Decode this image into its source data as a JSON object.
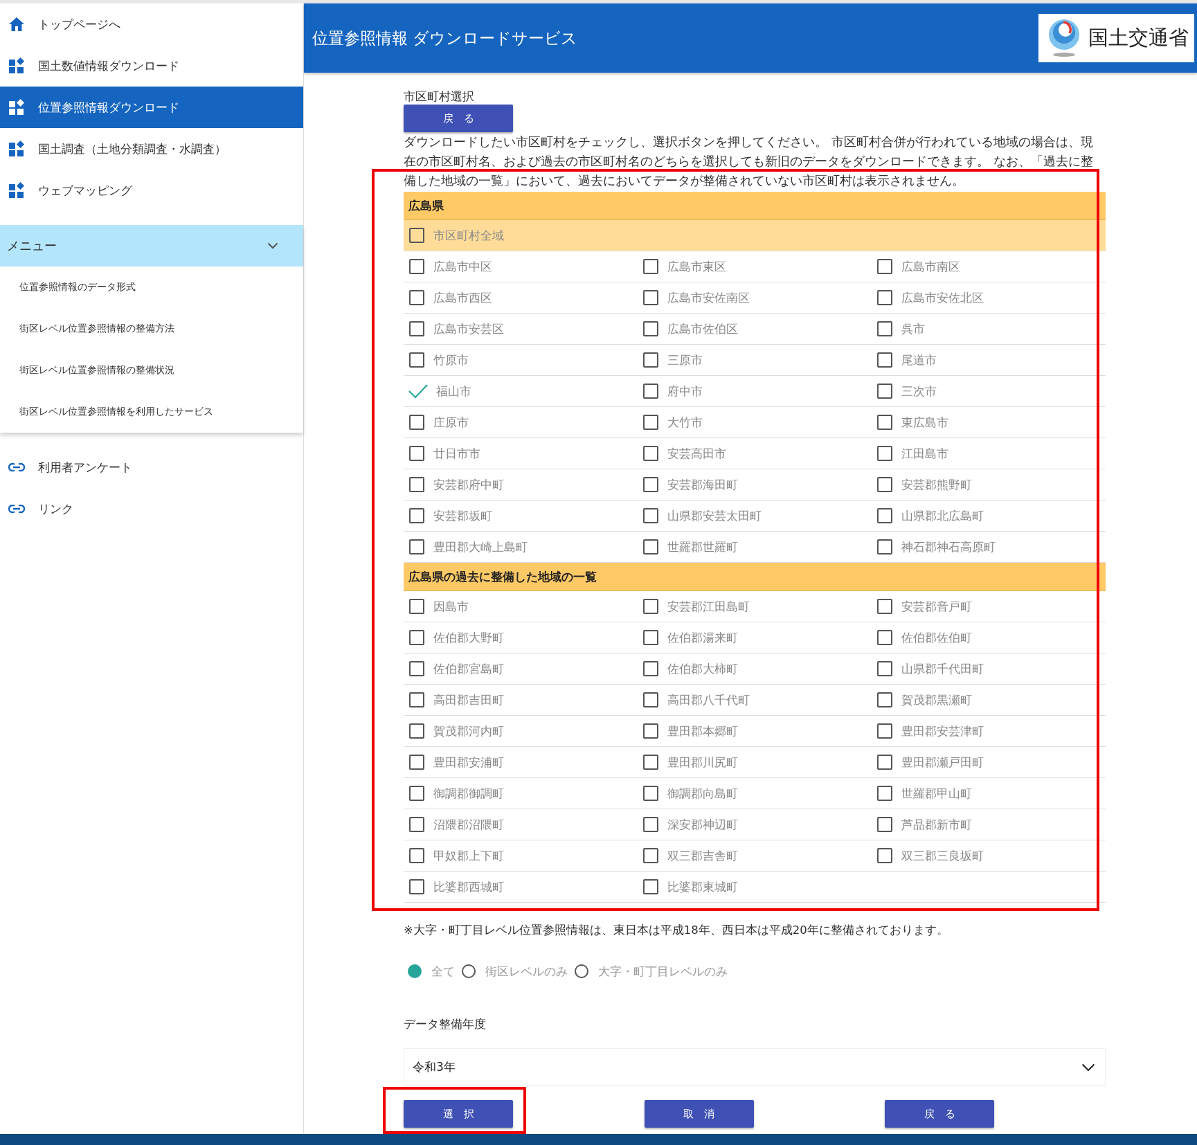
{
  "sidebar": {
    "nav_items": [
      {
        "label": "トップページへ",
        "kind": "home",
        "selected": false
      },
      {
        "label": "国土数値情報ダウンロード",
        "kind": "widget",
        "selected": false
      },
      {
        "label": "位置参照情報ダウンロード",
        "kind": "widget",
        "selected": true
      },
      {
        "label": "国土調査（土地分類調査・水調査）",
        "kind": "widget",
        "selected": false
      },
      {
        "label": "ウェブマッピング",
        "kind": "widget",
        "selected": false
      }
    ],
    "menu": {
      "title": "メニュー",
      "expanded": true,
      "items": [
        "位置参照情報のデータ形式",
        "街区レベル位置参照情報の整備方法",
        "街区レベル位置参照情報の整備状況",
        "街区レベル位置参照情報を利用したサービス"
      ]
    },
    "links": [
      "利用者アンケート",
      "リンク"
    ]
  },
  "header": {
    "title": "位置参照情報 ダウンロードサービス",
    "logo_text": "国土交通省"
  },
  "content": {
    "heading": "市区町村選択",
    "back_button": "戻　る",
    "description": "ダウンロードしたい市区町村をチェックし、選択ボタンを押してください。 市区町村合併が行われている地域の場合は、現在の市区町村名、および過去の市区町村名のどちらを選択しても新旧のデータをダウンロードできます。 なお、「過去に整備した地域の一覧」において、過去においてデータが整備されていない市区町村は表示されません。",
    "list_highlighted": true,
    "groups": [
      {
        "title": "広島県",
        "all_option": {
          "label": "市区町村全域",
          "checked": false
        },
        "items": [
          {
            "label": "広島市中区",
            "checked": false
          },
          {
            "label": "広島市東区",
            "checked": false
          },
          {
            "label": "広島市南区",
            "checked": false
          },
          {
            "label": "広島市西区",
            "checked": false
          },
          {
            "label": "広島市安佐南区",
            "checked": false
          },
          {
            "label": "広島市安佐北区",
            "checked": false
          },
          {
            "label": "広島市安芸区",
            "checked": false
          },
          {
            "label": "広島市佐伯区",
            "checked": false
          },
          {
            "label": "呉市",
            "checked": false
          },
          {
            "label": "竹原市",
            "checked": false
          },
          {
            "label": "三原市",
            "checked": false
          },
          {
            "label": "尾道市",
            "checked": false
          },
          {
            "label": "福山市",
            "checked": true
          },
          {
            "label": "府中市",
            "checked": false
          },
          {
            "label": "三次市",
            "checked": false
          },
          {
            "label": "庄原市",
            "checked": false
          },
          {
            "label": "大竹市",
            "checked": false
          },
          {
            "label": "東広島市",
            "checked": false
          },
          {
            "label": "廿日市市",
            "checked": false
          },
          {
            "label": "安芸高田市",
            "checked": false
          },
          {
            "label": "江田島市",
            "checked": false
          },
          {
            "label": "安芸郡府中町",
            "checked": false
          },
          {
            "label": "安芸郡海田町",
            "checked": false
          },
          {
            "label": "安芸郡熊野町",
            "checked": false
          },
          {
            "label": "安芸郡坂町",
            "checked": false
          },
          {
            "label": "山県郡安芸太田町",
            "checked": false
          },
          {
            "label": "山県郡北広島町",
            "checked": false
          },
          {
            "label": "豊田郡大崎上島町",
            "checked": false
          },
          {
            "label": "世羅郡世羅町",
            "checked": false
          },
          {
            "label": "神石郡神石高原町",
            "checked": false
          }
        ]
      },
      {
        "title": "広島県の過去に整備した地域の一覧",
        "items": [
          {
            "label": "因島市",
            "checked": false
          },
          {
            "label": "安芸郡江田島町",
            "checked": false
          },
          {
            "label": "安芸郡音戸町",
            "checked": false
          },
          {
            "label": "佐伯郡大野町",
            "checked": false
          },
          {
            "label": "佐伯郡湯来町",
            "checked": false
          },
          {
            "label": "佐伯郡佐伯町",
            "checked": false
          },
          {
            "label": "佐伯郡宮島町",
            "checked": false
          },
          {
            "label": "佐伯郡大柿町",
            "checked": false
          },
          {
            "label": "山県郡千代田町",
            "checked": false
          },
          {
            "label": "高田郡吉田町",
            "checked": false
          },
          {
            "label": "高田郡八千代町",
            "checked": false
          },
          {
            "label": "賀茂郡黒瀬町",
            "checked": false
          },
          {
            "label": "賀茂郡河内町",
            "checked": false
          },
          {
            "label": "豊田郡本郷町",
            "checked": false
          },
          {
            "label": "豊田郡安芸津町",
            "checked": false
          },
          {
            "label": "豊田郡安浦町",
            "checked": false
          },
          {
            "label": "豊田郡川尻町",
            "checked": false
          },
          {
            "label": "豊田郡瀬戸田町",
            "checked": false
          },
          {
            "label": "御調郡御調町",
            "checked": false
          },
          {
            "label": "御調郡向島町",
            "checked": false
          },
          {
            "label": "世羅郡甲山町",
            "checked": false
          },
          {
            "label": "沼隈郡沼隈町",
            "checked": false
          },
          {
            "label": "深安郡神辺町",
            "checked": false
          },
          {
            "label": "芦品郡新市町",
            "checked": false
          },
          {
            "label": "甲奴郡上下町",
            "checked": false
          },
          {
            "label": "双三郡吉舎町",
            "checked": false
          },
          {
            "label": "双三郡三良坂町",
            "checked": false
          },
          {
            "label": "比婆郡西城町",
            "checked": false
          },
          {
            "label": "比婆郡東城町",
            "checked": false
          }
        ]
      }
    ],
    "note": "※大字・町丁目レベル位置参照情報は、東日本は平成18年、西日本は平成20年に整備されております。",
    "radio_options": [
      {
        "label": "全て",
        "selected": true
      },
      {
        "label": "街区レベルのみ",
        "selected": false
      },
      {
        "label": "大字・町丁目レベルのみ",
        "selected": false
      }
    ],
    "year": {
      "label": "データ整備年度",
      "value": "令和3年"
    },
    "buttons": [
      {
        "label": "選　択",
        "highlighted": true
      },
      {
        "label": "取　消",
        "highlighted": false
      },
      {
        "label": "戻　る",
        "highlighted": false
      }
    ]
  }
}
